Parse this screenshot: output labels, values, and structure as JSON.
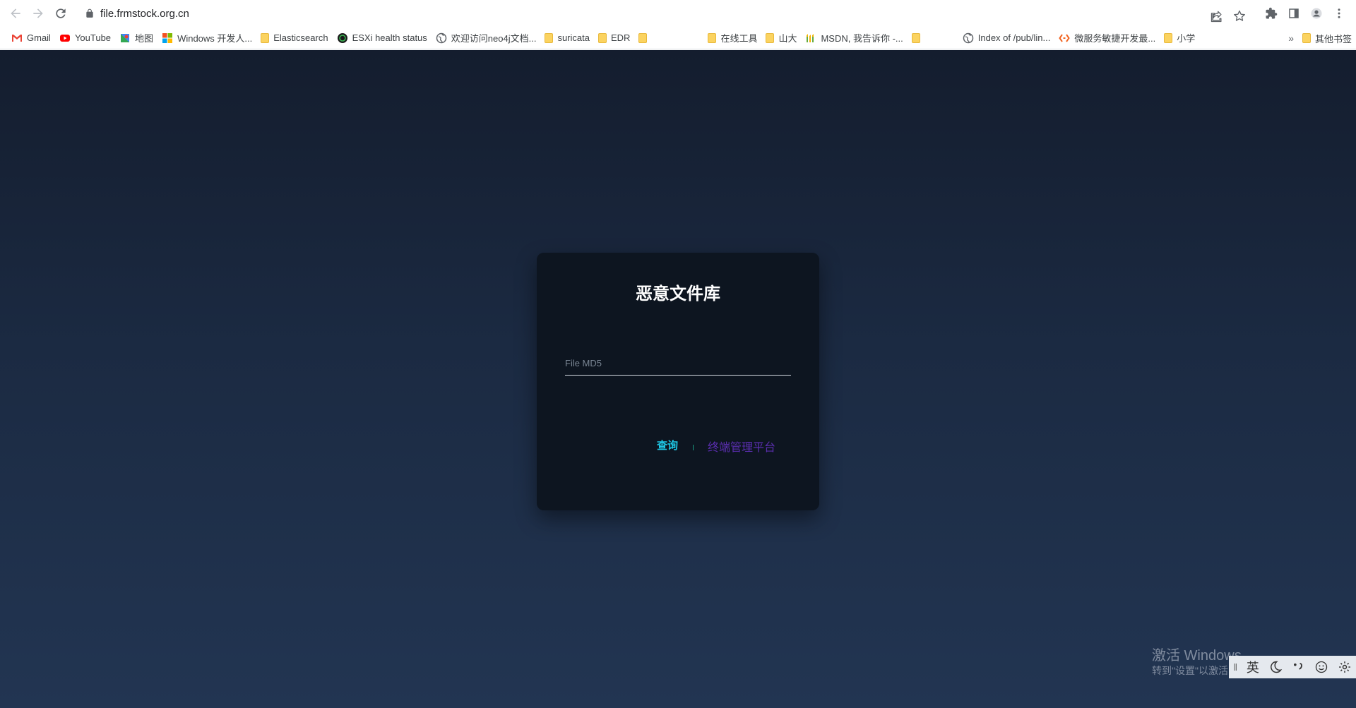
{
  "browser": {
    "url": "file.frmstock.org.cn"
  },
  "bookmarks": {
    "items": [
      "Gmail",
      "YouTube",
      "地图",
      "Windows 开发人...",
      "Elasticsearch",
      "ESXi health status",
      "欢迎访问neo4j文档...",
      "suricata",
      "EDR",
      "",
      "在线工具",
      "山大",
      "MSDN, 我告诉你 -...",
      "",
      "Index of /pub/lin...",
      "微服务敏捷开发最...",
      "小学"
    ],
    "more": "»",
    "other": "其他书签"
  },
  "page": {
    "title": "恶意文件库",
    "md5_placeholder": "File MD5",
    "query_label": "查询",
    "platform_label": "终端管理平台"
  },
  "watermark": {
    "title": "激活 Windows",
    "subtitle": "转到\"设置\"以激活"
  },
  "ime": {
    "lang": "英"
  },
  "colors": {
    "query": "#1ec8e6",
    "platform": "#5b2eb0",
    "card": "#0d1520"
  }
}
